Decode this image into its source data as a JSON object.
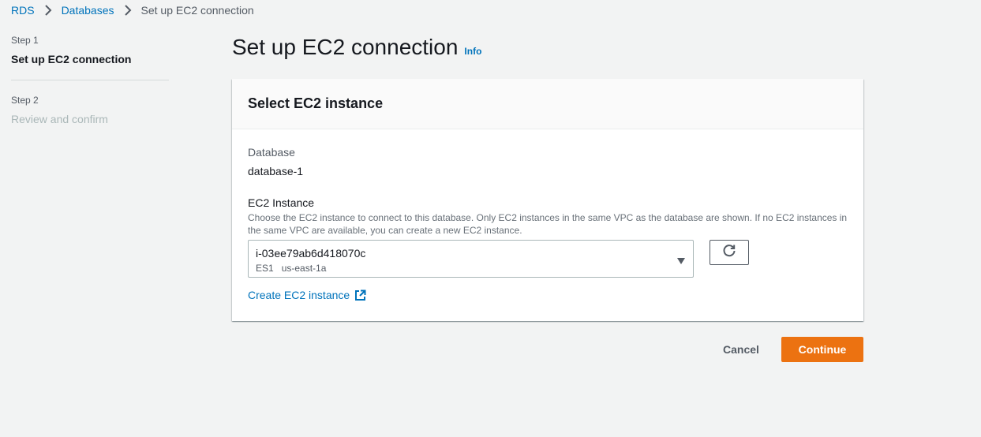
{
  "breadcrumb": {
    "items": [
      {
        "label": "RDS"
      },
      {
        "label": "Databases"
      },
      {
        "label": "Set up EC2 connection"
      }
    ]
  },
  "steps": [
    {
      "number": "Step 1",
      "title": "Set up EC2 connection",
      "active": true
    },
    {
      "number": "Step 2",
      "title": "Review and confirm",
      "active": false
    }
  ],
  "main": {
    "title": "Set up EC2 connection",
    "info": "Info"
  },
  "panel": {
    "header": "Select EC2 instance",
    "database_label": "Database",
    "database_value": "database-1",
    "ec2_label": "EC2 Instance",
    "ec2_description": "Choose the EC2 instance to connect to this database. Only EC2 instances in the same VPC as the database are shown. If no EC2 instances in the same VPC are available, you can create a new EC2 instance.",
    "select": {
      "value": "i-03ee79ab6d418070c",
      "meta_name": "ES1",
      "meta_zone": "us-east-1a"
    },
    "create_link": "Create EC2 instance"
  },
  "actions": {
    "cancel": "Cancel",
    "continue": "Continue"
  },
  "colors": {
    "link": "#0073bb",
    "primary": "#ec7211",
    "background": "#f2f3f3"
  },
  "icons": [
    "chevron-right-icon",
    "caret-down-icon",
    "refresh-icon",
    "external-link-icon"
  ]
}
